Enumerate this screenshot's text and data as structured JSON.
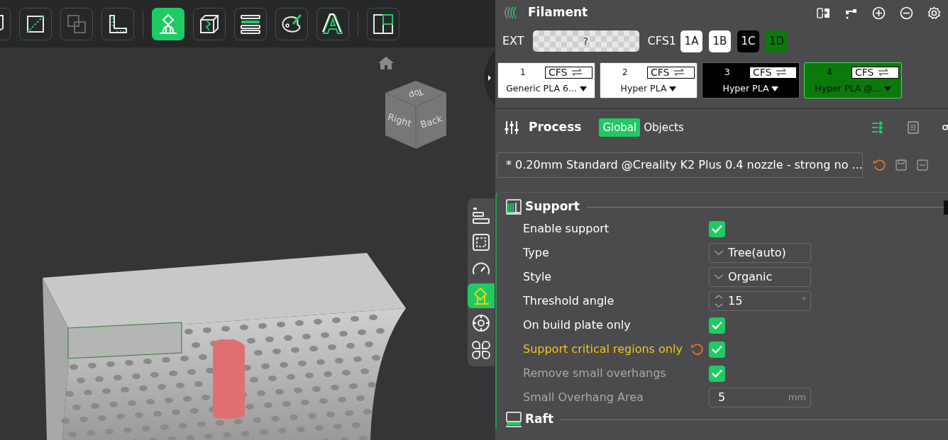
{
  "toolbar": {
    "buttons": [
      {
        "selected": false
      },
      {
        "selected": false
      },
      {
        "selected": false
      },
      {
        "selected": false
      },
      {
        "selected": true
      },
      {
        "selected": false
      },
      {
        "selected": false
      },
      {
        "selected": false
      },
      {
        "selected": false
      },
      {
        "selected": false
      }
    ]
  },
  "view_cube": {
    "faces": [
      "Top",
      "Right",
      "Back"
    ]
  },
  "side_toolbar": [
    {
      "selected": false
    },
    {
      "selected": false
    },
    {
      "selected": false
    },
    {
      "selected": true
    },
    {
      "selected": false
    },
    {
      "selected": false
    }
  ],
  "filament": {
    "title": "Filament",
    "ext": {
      "label": "EXT",
      "value": "?"
    },
    "cfs": {
      "label": "CFS1",
      "slots": [
        {
          "label": "1A",
          "color": "#ffffff"
        },
        {
          "label": "1B",
          "color": "#ffffff"
        },
        {
          "label": "1C",
          "color": "#000000"
        },
        {
          "label": "1D",
          "color": "#0a7a0a"
        }
      ]
    },
    "cards": [
      {
        "number": "1",
        "tag": "CFS",
        "name": "Generic PLA 6...",
        "color": "#ffffff"
      },
      {
        "number": "2",
        "tag": "CFS",
        "name": "Hyper PLA",
        "color": "#ffffff"
      },
      {
        "number": "3",
        "tag": "CFS",
        "name": "Hyper PLA",
        "color": "#000000"
      },
      {
        "number": "4",
        "tag": "CFS",
        "name": "Hyper PLA @...",
        "color": "#0a7a0a"
      }
    ]
  },
  "process": {
    "title": "Process",
    "scope_tabs": [
      {
        "label": "Global",
        "selected": true
      },
      {
        "label": "Objects",
        "selected": false
      }
    ],
    "preset": {
      "value": "* 0.20mm Standard @Creality K2 Plus 0.4 nozzle - strong no ..."
    },
    "sections": [
      {
        "title": "Support",
        "rows": [
          {
            "kind": "checkbox",
            "label": "Enable support",
            "checked": true,
            "modified": false,
            "disabled": false
          },
          {
            "kind": "select",
            "label": "Type",
            "value": "Tree(auto)",
            "modified": false,
            "disabled": false
          },
          {
            "kind": "select",
            "label": "Style",
            "value": "Organic",
            "modified": false,
            "disabled": false
          },
          {
            "kind": "spin",
            "label": "Threshold angle",
            "value": "15",
            "unit": "°",
            "modified": false,
            "disabled": false
          },
          {
            "kind": "checkbox",
            "label": "On build plate only",
            "checked": true,
            "modified": false,
            "disabled": false
          },
          {
            "kind": "checkbox",
            "label": "Support critical regions only",
            "checked": true,
            "modified": true,
            "disabled": false
          },
          {
            "kind": "checkbox",
            "label": "Remove small overhangs",
            "checked": true,
            "modified": false,
            "disabled": true
          },
          {
            "kind": "number",
            "label": "Small Overhang Area",
            "value": "5",
            "unit": "mm",
            "modified": false,
            "disabled": true
          }
        ]
      },
      {
        "title": "Raft"
      }
    ]
  }
}
